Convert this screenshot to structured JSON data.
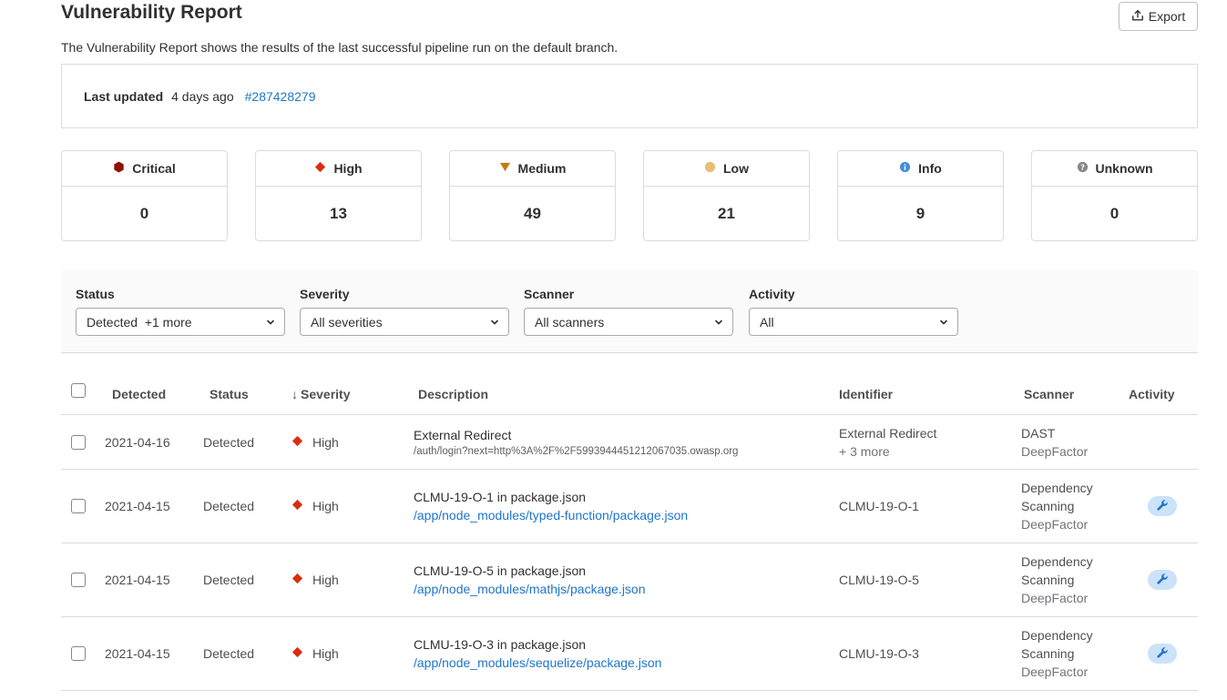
{
  "header": {
    "title": "Vulnerability Report",
    "export_label": "Export",
    "description": "The Vulnerability Report shows the results of the last successful pipeline run on the default branch."
  },
  "last_updated": {
    "label": "Last updated",
    "ago": "4 days ago",
    "pipeline_link": "#287428279"
  },
  "severity_counts": [
    {
      "label": "Critical",
      "count": "0",
      "icon": "severity-critical-icon",
      "color": "#8d1300"
    },
    {
      "label": "High",
      "count": "13",
      "icon": "severity-high-icon",
      "color": "#dd2b0e"
    },
    {
      "label": "Medium",
      "count": "49",
      "icon": "severity-medium-icon",
      "color": "#c17d10"
    },
    {
      "label": "Low",
      "count": "21",
      "icon": "severity-low-icon",
      "color": "#e9be74"
    },
    {
      "label": "Info",
      "count": "9",
      "icon": "severity-info-icon",
      "color": "#428fdc"
    },
    {
      "label": "Unknown",
      "count": "0",
      "icon": "severity-unknown-icon",
      "color": "#868686"
    }
  ],
  "filters": [
    {
      "label": "Status",
      "value": "Detected  +1 more"
    },
    {
      "label": "Severity",
      "value": "All severities"
    },
    {
      "label": "Scanner",
      "value": "All scanners"
    },
    {
      "label": "Activity",
      "value": "All"
    }
  ],
  "table": {
    "columns": {
      "detected": "Detected",
      "status": "Status",
      "sort_arrow": "↓",
      "severity": "Severity",
      "description": "Description",
      "identifier": "Identifier",
      "scanner": "Scanner",
      "activity": "Activity"
    },
    "rows": [
      {
        "detected": "2021-04-16",
        "status": "Detected",
        "severity": "High",
        "title": "External Redirect",
        "path": "/auth/login?next=http%3A%2F%2F5993944451212067035.owasp.org",
        "identifier": "External Redirect",
        "identifier_more": "+ 3 more",
        "scanner_line1": "DAST",
        "scanner_line2": "",
        "scanner_vendor": "DeepFactor",
        "has_activity": false
      },
      {
        "detected": "2021-04-15",
        "status": "Detected",
        "severity": "High",
        "title": "CLMU-19-O-1 in package.json",
        "path": "/app/node_modules/typed-function/package.json",
        "identifier": "CLMU-19-O-1",
        "identifier_more": "",
        "scanner_line1": "Dependency",
        "scanner_line2": "Scanning",
        "scanner_vendor": "DeepFactor",
        "has_activity": true
      },
      {
        "detected": "2021-04-15",
        "status": "Detected",
        "severity": "High",
        "title": "CLMU-19-O-5 in package.json",
        "path": "/app/node_modules/mathjs/package.json",
        "identifier": "CLMU-19-O-5",
        "identifier_more": "",
        "scanner_line1": "Dependency",
        "scanner_line2": "Scanning",
        "scanner_vendor": "DeepFactor",
        "has_activity": true
      },
      {
        "detected": "2021-04-15",
        "status": "Detected",
        "severity": "High",
        "title": "CLMU-19-O-3 in package.json",
        "path": "/app/node_modules/sequelize/package.json",
        "identifier": "CLMU-19-O-3",
        "identifier_more": "",
        "scanner_line1": "Dependency",
        "scanner_line2": "Scanning",
        "scanner_vendor": "DeepFactor",
        "has_activity": true
      }
    ]
  },
  "colors": {
    "link": "#1f75cb",
    "activity_badge_bg": "#cbe2f9",
    "activity_icon": "#1f75cb",
    "border": "#dbdbdb",
    "filter_bar_bg": "#fafafa"
  }
}
